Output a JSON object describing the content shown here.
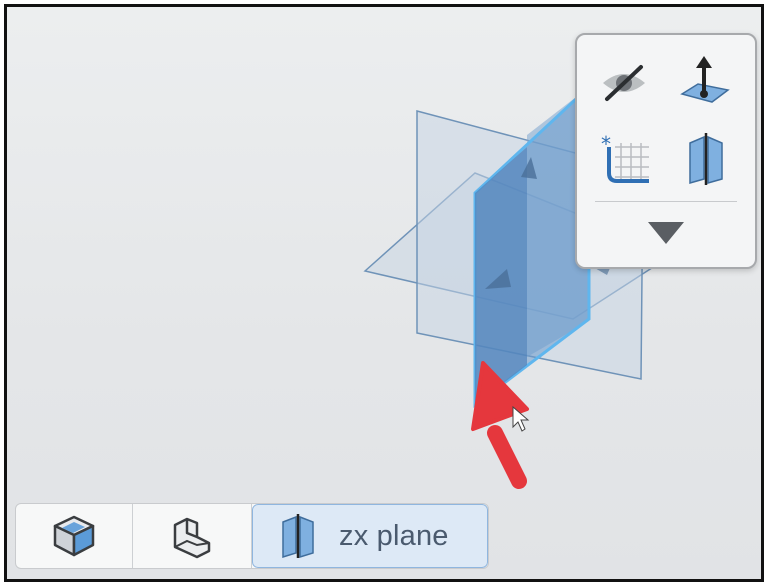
{
  "viewport": {
    "background": "#e6e8ea",
    "selected_plane": "zx-plane"
  },
  "mini_toolbar": {
    "buttons": [
      {
        "icon": "hide-eye-icon"
      },
      {
        "icon": "move-up-plane-icon"
      },
      {
        "icon": "sketch-on-plane-icon"
      },
      {
        "icon": "mirror-plane-icon"
      }
    ],
    "more_icon": "triangle-down-icon"
  },
  "selection_filter": {
    "items": [
      {
        "icon": "body-cube-icon"
      },
      {
        "icon": "face-solid-icon"
      },
      {
        "icon": "plane-icon",
        "label": "zx plane",
        "selected": true
      }
    ]
  },
  "colors": {
    "plane_fill": "#b9cde0",
    "plane_edge": "#6f93b8",
    "selected_plane": "#5e8fc4",
    "highlight_edge": "#5fb6ee",
    "arrow": "#e5373d",
    "label": "#4a5a6e"
  }
}
